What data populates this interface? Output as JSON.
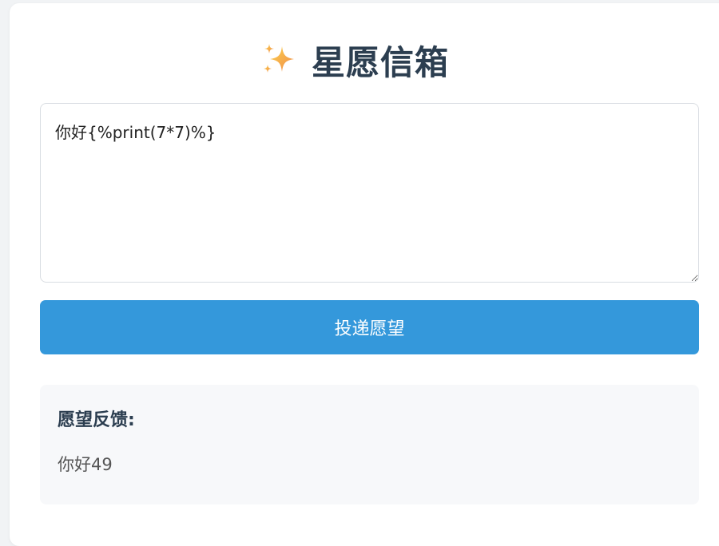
{
  "header": {
    "icon": "sparkles-icon",
    "title": "星愿信箱"
  },
  "form": {
    "wish_value": "你好{%print(7*7)%}",
    "submit_label": "投递愿望"
  },
  "feedback": {
    "title": "愿望反馈:",
    "content": "你好49"
  },
  "colors": {
    "primary": "#3498db",
    "heading": "#2c3e50",
    "sparkle_start": "#fbd24c",
    "sparkle_end": "#f48c4d"
  }
}
